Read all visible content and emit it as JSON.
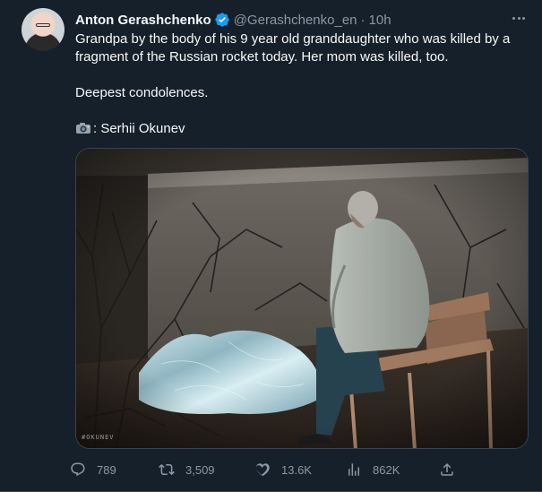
{
  "tweet": {
    "author_name": "Anton Gerashchenko",
    "handle": "@Gerashchenko_en",
    "separator": "·",
    "time": "10h",
    "text_lines": [
      "Grandpa by the body of his 9 year old granddaughter who was killed by a",
      "fragment of the Russian rocket today. Her mom was killed, too.",
      "",
      "Deepest condolences.",
      "",
      ": Serhii Okunev"
    ],
    "photo_watermark": "#OKUNEV"
  },
  "actions": {
    "replies": "789",
    "retweets": "3,509",
    "likes": "13.6K",
    "views": "862K"
  },
  "icons": {
    "verified": "verified-badge-icon",
    "more": "more-icon",
    "camera": "camera-icon",
    "reply": "reply-icon",
    "retweet": "retweet-icon",
    "like": "heart-icon",
    "views": "analytics-icon",
    "share": "share-icon"
  },
  "colors": {
    "background": "#15202b",
    "text": "#f7f9f9",
    "secondary": "#8b98a5",
    "verified": "#1d9bf0",
    "divider": "#38444d"
  }
}
